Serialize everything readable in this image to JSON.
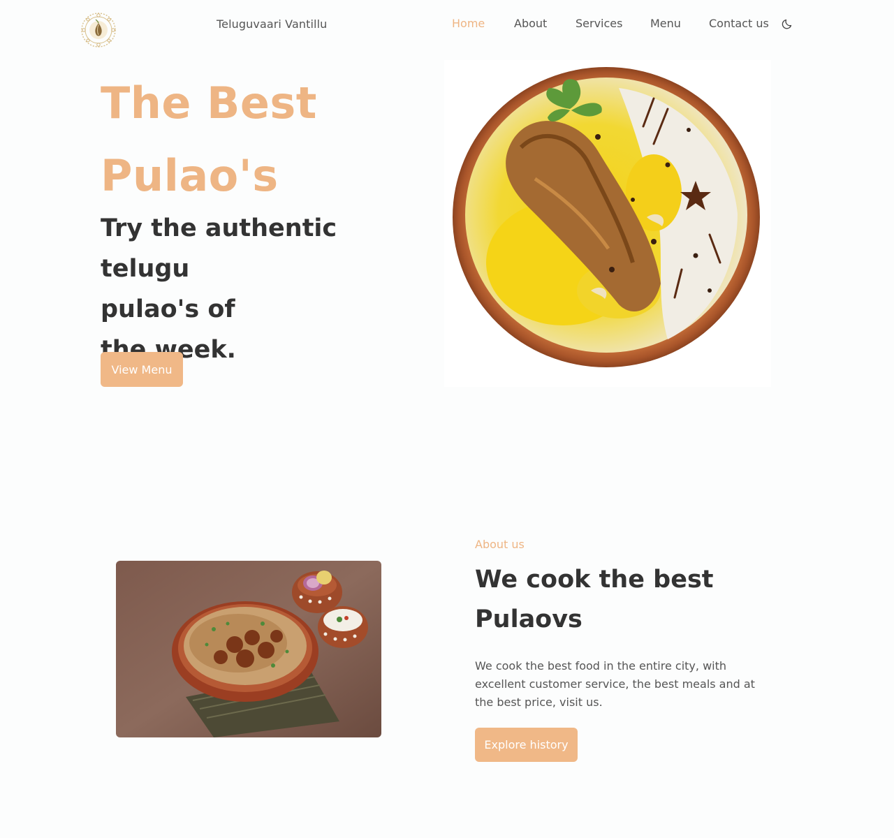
{
  "header": {
    "logo_icon": "onion-emblem-logo",
    "brand": "Teluguvaari Vantillu",
    "nav": [
      {
        "label": "Home",
        "active": true
      },
      {
        "label": "About",
        "active": false
      },
      {
        "label": "Services",
        "active": false
      },
      {
        "label": "Menu",
        "active": false
      },
      {
        "label": "Contact us",
        "active": false
      }
    ],
    "theme_toggle_icon": "moon-icon"
  },
  "hero": {
    "title_line1": "The Best",
    "title_line2": "Pulao's",
    "subtitle_line1": "Try the authentic telugu",
    "subtitle_line2": "pulao's of",
    "subtitle_line3": "the week.",
    "cta_label": "View Menu",
    "image": "biryani-plate-image"
  },
  "about": {
    "image": "pulao-clay-pot-image",
    "kicker": "About us",
    "title_line1": "We cook the best",
    "title_line2": "Pulaovs",
    "text": "We cook the best food in the entire city, with excellent customer service, the best meals and at the best price, visit us.",
    "cta_label": "Explore history"
  },
  "colors": {
    "accent": "#eeb584",
    "button": "#f0b887",
    "heading": "#333333",
    "body_text": "#555555",
    "background": "#fcfdfd"
  }
}
